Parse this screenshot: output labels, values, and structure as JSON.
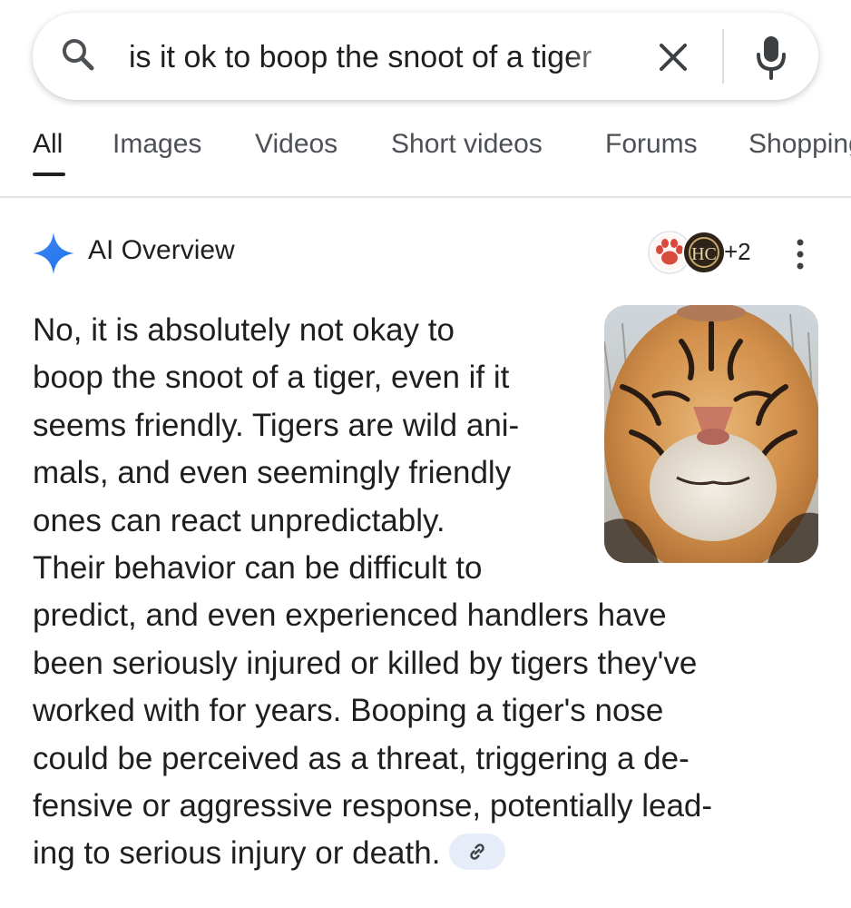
{
  "search": {
    "query": "is it ok to boop the snoot of a tiger"
  },
  "tabs": [
    "All",
    "Images",
    "Videos",
    "Short videos",
    "Forums",
    "Shopping"
  ],
  "ai_overview": {
    "title": "AI Overview",
    "source_count": "+2",
    "source_icon_text": "HC",
    "image_alt": "Tiger photo",
    "lines": [
      "No, it is absolutely not okay to",
      "boop the snoot of a tiger, even if it",
      "seems friendly. Tigers are wild ani-",
      "mals, and even seemingly friendly",
      "ones can react unpredictably.",
      "Their behavior can be difficult to",
      "predict, and even experienced handlers have",
      "been seriously injured or killed by tigers they've",
      "worked with for years. Booping a tiger's nose",
      "could be perceived as a threat, triggering a de-",
      "fensive or aggressive response, potentially lead-",
      "ing to serious injury or death."
    ]
  },
  "colors": {
    "accent_blue": "#4285f4",
    "text": "#1f1f1f",
    "muted": "#4d5156",
    "chip_bg": "#e7edf8"
  }
}
